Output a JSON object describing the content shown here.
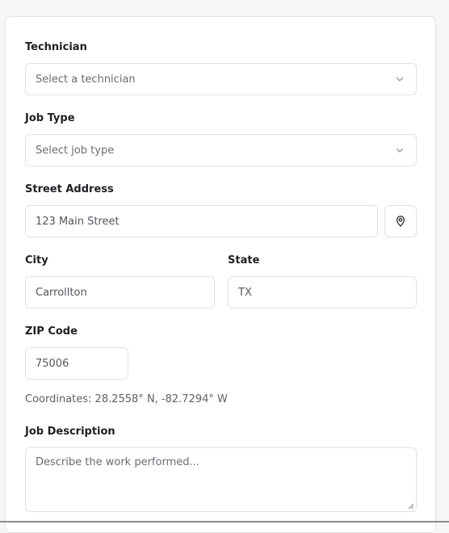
{
  "form": {
    "technician": {
      "label": "Technician",
      "placeholder": "Select a technician"
    },
    "job_type": {
      "label": "Job Type",
      "placeholder": "Select job type"
    },
    "street": {
      "label": "Street Address",
      "value": "123 Main Street"
    },
    "city": {
      "label": "City",
      "value": "Carrollton"
    },
    "state": {
      "label": "State",
      "value": "TX"
    },
    "zip": {
      "label": "ZIP Code",
      "value": "75006"
    },
    "coordinates": "Coordinates: 28.2558° N, -82.7294° W",
    "description": {
      "label": "Job Description",
      "placeholder": "Describe the work performed..."
    }
  },
  "icons": {
    "select_chevron": "chevron-down-icon",
    "locate": "map-pin-icon",
    "resize": "resize-handle-icon"
  }
}
